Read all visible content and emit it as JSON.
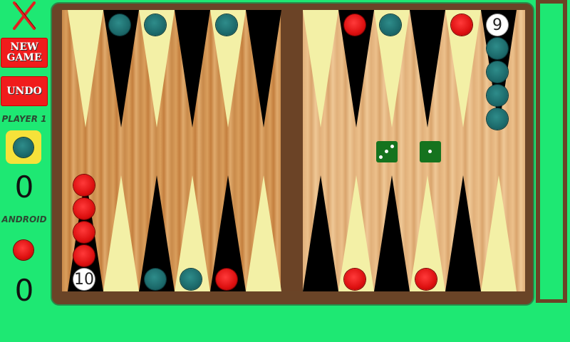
{
  "sidebar": {
    "close_icon": "x-close-icon",
    "new_game_line1": "NEW",
    "new_game_line2": "GAME",
    "undo_label": "UNDO",
    "player1_label": "PLAYER 1",
    "player1_score": "0",
    "android_label": "ANDROID",
    "android_score": "0"
  },
  "board": {
    "stack_count_top_right": "9",
    "stack_count_bottom_left": "10",
    "dice": [
      3,
      1
    ]
  },
  "colors": {
    "background": "#1ee873",
    "button": "#f01c1c",
    "player_checker": "teal",
    "android_checker": "red"
  }
}
